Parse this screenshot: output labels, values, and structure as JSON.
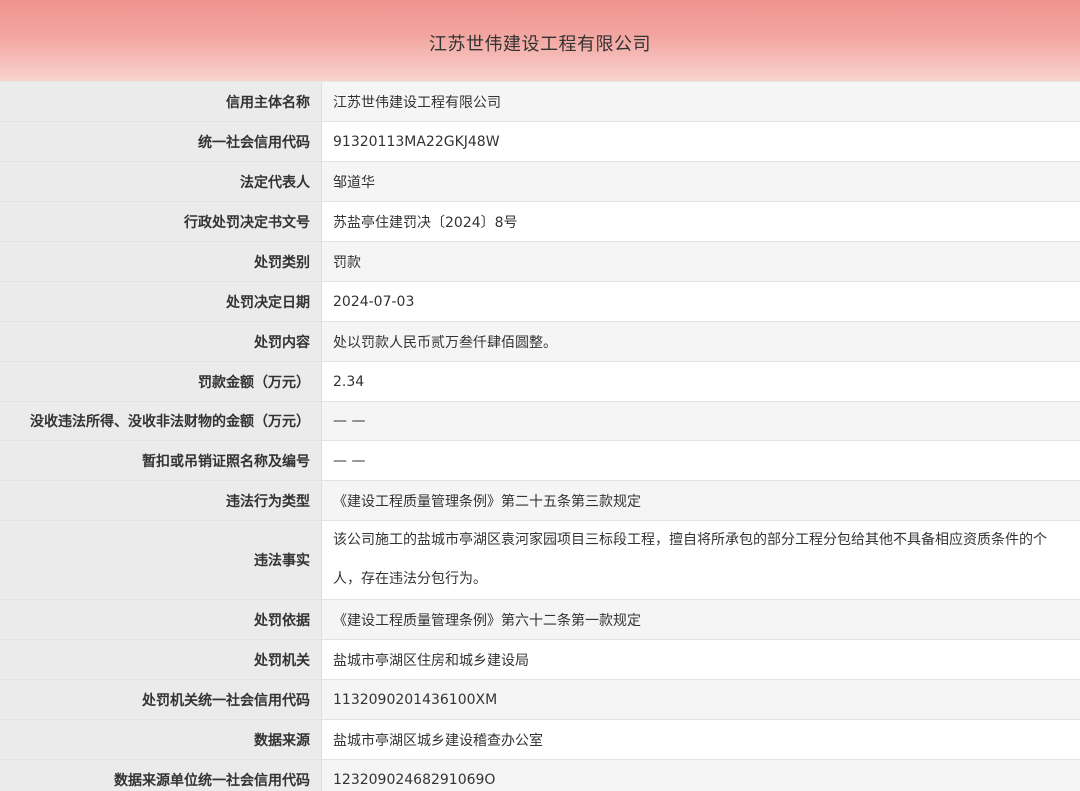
{
  "header": {
    "title": "江苏世伟建设工程有限公司"
  },
  "rows": [
    {
      "label": "信用主体名称",
      "value": "江苏世伟建设工程有限公司"
    },
    {
      "label": "统一社会信用代码",
      "value": "91320113MA22GKJ48W"
    },
    {
      "label": "法定代表人",
      "value": "邹道华"
    },
    {
      "label": "行政处罚决定书文号",
      "value": "苏盐亭住建罚决〔2024〕8号"
    },
    {
      "label": "处罚类别",
      "value": "罚款"
    },
    {
      "label": "处罚决定日期",
      "value": "2024-07-03"
    },
    {
      "label": "处罚内容",
      "value": "处以罚款人民币贰万叁仟肆佰圆整。"
    },
    {
      "label": "罚款金额（万元）",
      "value": "2.34"
    },
    {
      "label": "没收违法所得、没收非法财物的金额（万元）",
      "value": "— —"
    },
    {
      "label": "暂扣或吊销证照名称及编号",
      "value": "— —"
    },
    {
      "label": "违法行为类型",
      "value": "《建设工程质量管理条例》第二十五条第三款规定"
    },
    {
      "label": "违法事实",
      "value": "该公司施工的盐城市亭湖区袁河家园项目三标段工程，擅自将所承包的部分工程分包给其他不具备相应资质条件的个人，存在违法分包行为。"
    },
    {
      "label": "处罚依据",
      "value": "《建设工程质量管理条例》第六十二条第一款规定"
    },
    {
      "label": "处罚机关",
      "value": "盐城市亭湖区住房和城乡建设局"
    },
    {
      "label": "处罚机关统一社会信用代码",
      "value": "1132090201436100XM"
    },
    {
      "label": "数据来源",
      "value": "盐城市亭湖区城乡建设稽查办公室"
    },
    {
      "label": "数据来源单位统一社会信用代码",
      "value": "12320902468291069O"
    }
  ]
}
